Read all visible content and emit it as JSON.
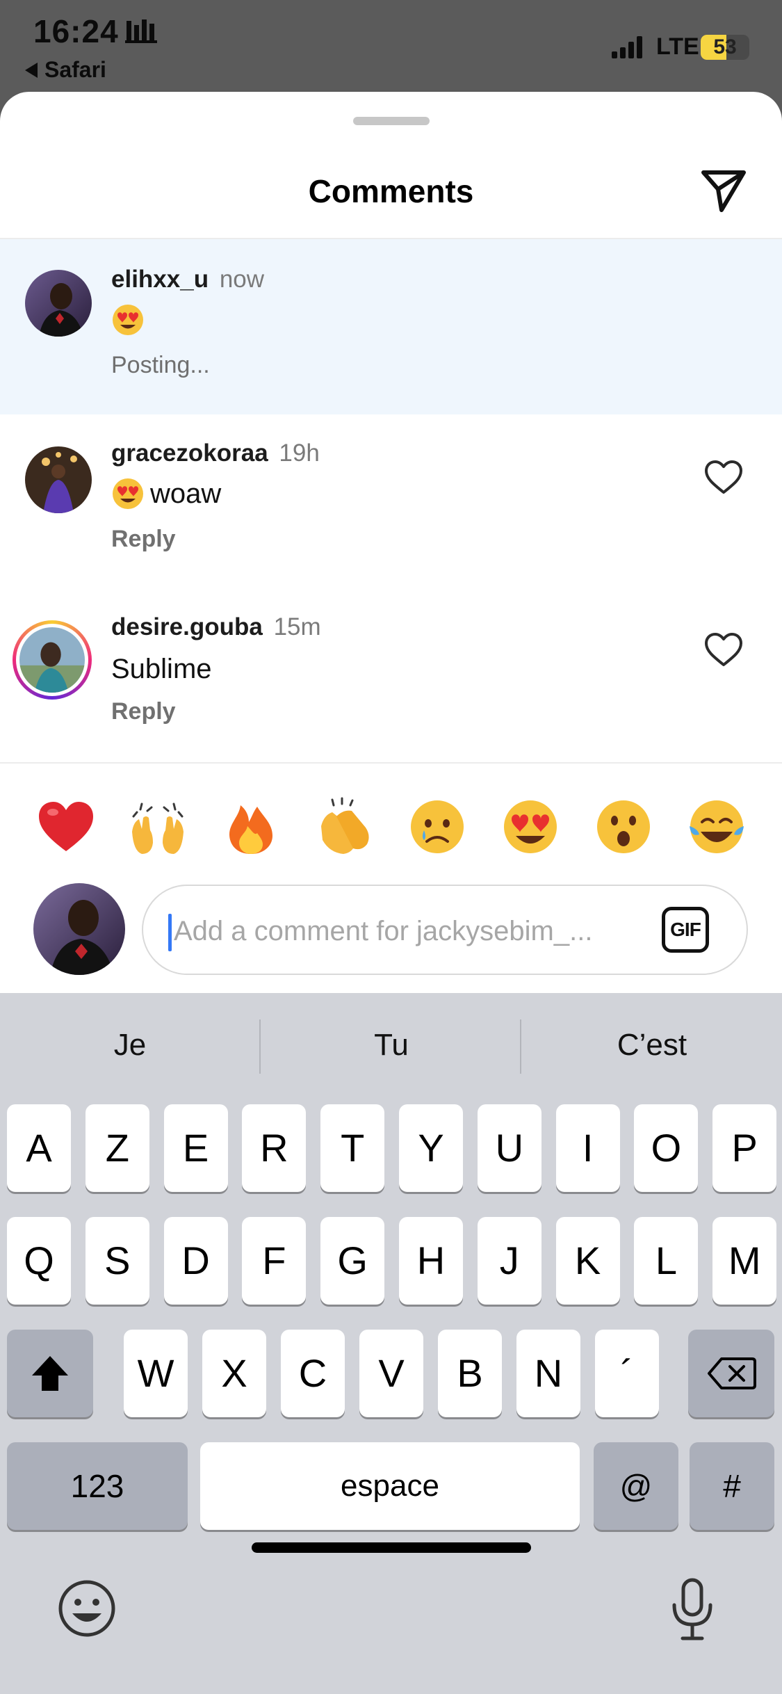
{
  "status_bar": {
    "time": "16:24",
    "back_app": "Safari",
    "network": "LTE",
    "battery": "53",
    "battery_level": 0.53
  },
  "sheet": {
    "title": "Comments"
  },
  "comments": [
    {
      "username": "elihxx_u",
      "time": "now",
      "emoji": "heart-eyes",
      "text": "",
      "status": "Posting...",
      "state": "posting"
    },
    {
      "username": "gracezokoraa",
      "time": "19h",
      "emoji": "heart-eyes",
      "text": "woaw",
      "reply_label": "Reply"
    },
    {
      "username": "desire.gouba",
      "time": "15m",
      "emoji": "",
      "text": "Sublime",
      "reply_label": "Reply"
    }
  ],
  "reactions": [
    "red-heart",
    "raising-hands",
    "fire",
    "clapping-hands",
    "crying-face",
    "heart-eyes",
    "surprised-face",
    "tears-of-joy"
  ],
  "composer": {
    "placeholder": "Add a comment for jackysebim_...",
    "gif_label": "GIF"
  },
  "keyboard": {
    "suggestions": [
      "Je",
      "Tu",
      "C’est"
    ],
    "row1": [
      "A",
      "Z",
      "E",
      "R",
      "T",
      "Y",
      "U",
      "I",
      "O",
      "P"
    ],
    "row2": [
      "Q",
      "S",
      "D",
      "F",
      "G",
      "H",
      "J",
      "K",
      "L",
      "M"
    ],
    "row3": [
      "W",
      "X",
      "C",
      "V",
      "B",
      "N",
      "´"
    ],
    "numbers_label": "123",
    "space_label": "espace",
    "at_label": "@",
    "hash_label": "#"
  },
  "colors": {
    "posting_bg": "#eff6fd",
    "caret": "#3478f6",
    "keyboard_bg": "#d1d3d9",
    "battery": "#f6d542"
  }
}
